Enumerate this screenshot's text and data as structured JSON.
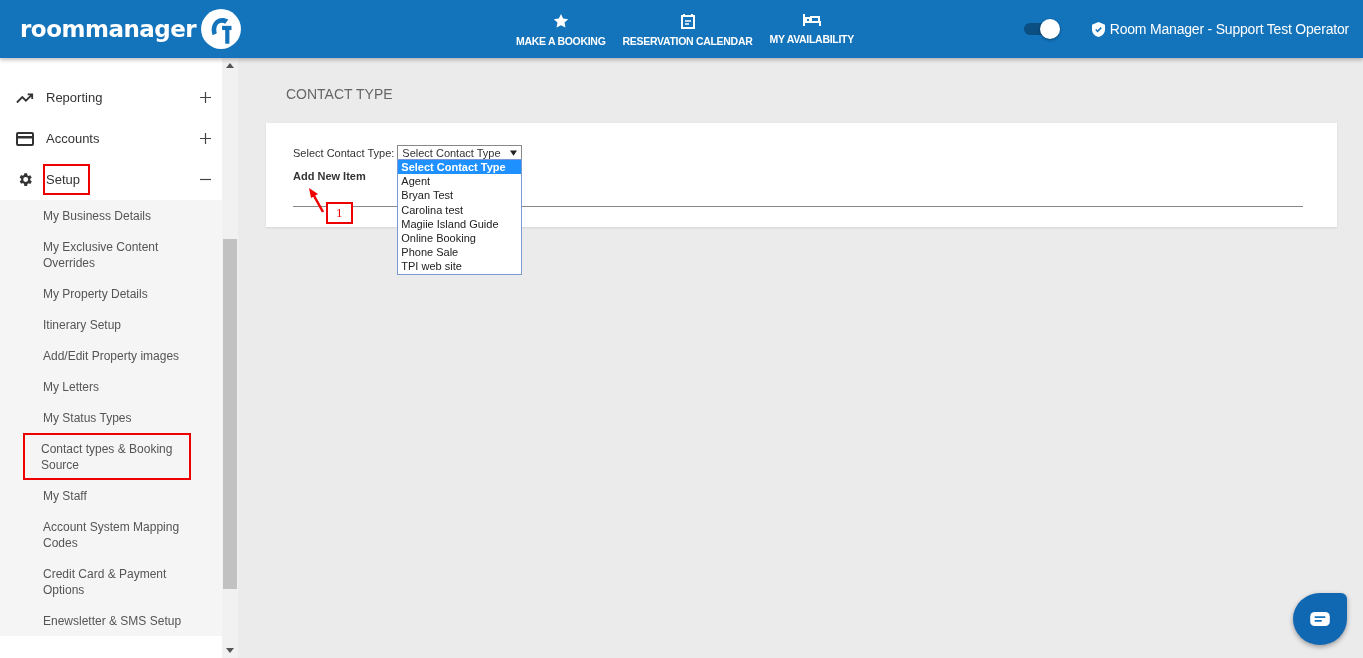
{
  "header": {
    "logo": "roommanager",
    "nav": [
      {
        "label": "MAKE A BOOKING"
      },
      {
        "label": "RESERVATION CALENDAR"
      },
      {
        "label": "MY AVAILABILITY"
      }
    ],
    "toggle_on": true,
    "user": "Room Manager - Support Test Operator"
  },
  "sidebar": {
    "items": [
      {
        "label": "Reporting",
        "expanded": false,
        "highlighted": false
      },
      {
        "label": "Accounts",
        "expanded": false,
        "highlighted": false
      },
      {
        "label": "Setup",
        "expanded": true,
        "highlighted": true,
        "children": [
          {
            "label": "My Business Details",
            "highlighted": false
          },
          {
            "label": "My Exclusive Content Overrides",
            "highlighted": false
          },
          {
            "label": "My Property Details",
            "highlighted": false
          },
          {
            "label": "Itinerary Setup",
            "highlighted": false
          },
          {
            "label": "Add/Edit Property images",
            "highlighted": false
          },
          {
            "label": "My Letters",
            "highlighted": false
          },
          {
            "label": "My Status Types",
            "highlighted": false
          },
          {
            "label": "Contact types & Booking Source",
            "highlighted": true
          },
          {
            "label": "My Staff",
            "highlighted": false
          },
          {
            "label": "Account System Mapping Codes",
            "highlighted": false
          },
          {
            "label": "Credit Card & Payment Options",
            "highlighted": false
          },
          {
            "label": "Enewsletter & SMS Setup",
            "highlighted": false
          }
        ]
      }
    ]
  },
  "page": {
    "title": "CONTACT TYPE",
    "select_label": "Select Contact Type:",
    "select_value": "Select Contact Type",
    "options": [
      {
        "label": "Select Contact Type",
        "selected": true
      },
      {
        "label": "Agent",
        "selected": false
      },
      {
        "label": "Bryan Test",
        "selected": false
      },
      {
        "label": "Carolina test",
        "selected": false
      },
      {
        "label": "Magiie Island Guide",
        "selected": false
      },
      {
        "label": "Online Booking",
        "selected": false
      },
      {
        "label": "Phone Sale",
        "selected": false
      },
      {
        "label": "TPI web site",
        "selected": false
      }
    ],
    "add_link": "Add New Item",
    "annotation": "1"
  }
}
